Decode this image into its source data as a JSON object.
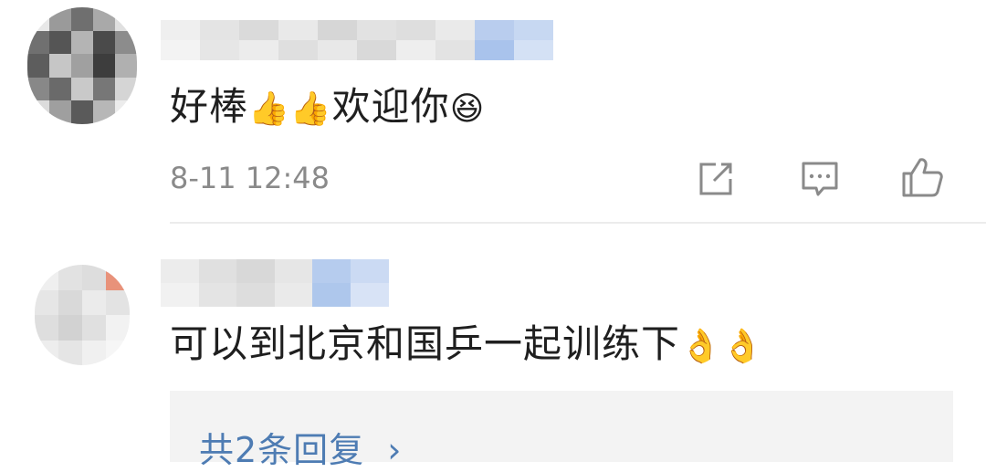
{
  "comments": [
    {
      "text": "好棒",
      "emojis_after_text": [
        "👍",
        "👍"
      ],
      "text_2": "欢迎你",
      "emoji_end": "😆",
      "timestamp": "8-11 12:48",
      "actions": [
        {
          "name": "share-icon"
        },
        {
          "name": "reply-comment-icon"
        },
        {
          "name": "like-icon"
        }
      ]
    },
    {
      "text": "可以到北京和国乒一起训练下",
      "emojis_after_text": [
        "👌",
        "👌"
      ],
      "replies_label": "共2条回复",
      "replies_chevron": "›"
    }
  ],
  "colors": {
    "link": "#4e7cb3",
    "timestamp": "#8a8a8a",
    "divider": "#ececec",
    "reply_bg": "#f3f3f3"
  }
}
